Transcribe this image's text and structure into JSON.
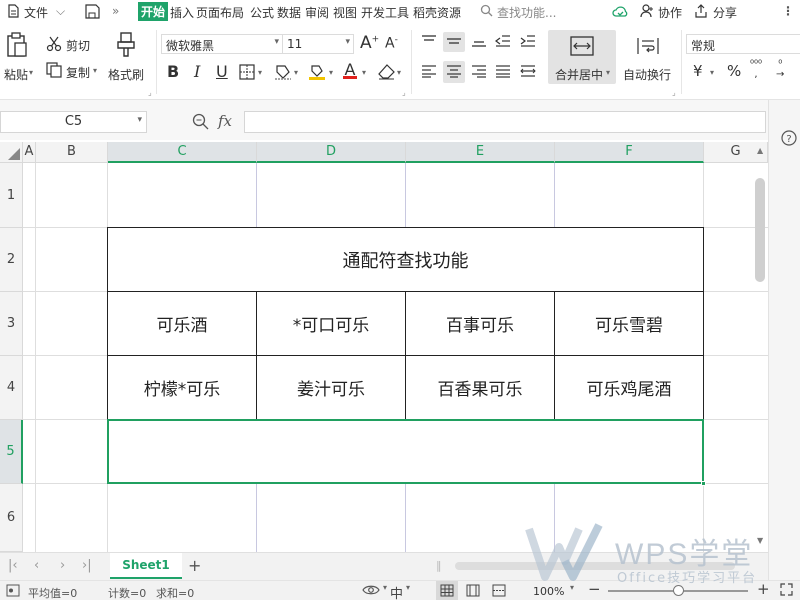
{
  "menu": {
    "file": "文件",
    "tabs": [
      "开始",
      "插入",
      "页面布局",
      "公式",
      "数据",
      "审阅",
      "视图",
      "开发工具",
      "稻壳资源"
    ],
    "search": "查找功能...",
    "collab": "协作",
    "share": "分享"
  },
  "ribbon": {
    "paste": "粘贴",
    "cut": "剪切",
    "copy": "复制",
    "format_painter": "格式刷",
    "font_name": "微软雅黑",
    "font_size": "11",
    "merge_center": "合并居中",
    "wrap_text": "自动换行",
    "number_format": "常规",
    "currency_symbol": "¥",
    "percent_symbol": "%"
  },
  "formula_bar": {
    "name_box": "C5",
    "fx": "fx",
    "content": ""
  },
  "sheet": {
    "columns": [
      "A",
      "B",
      "C",
      "D",
      "E",
      "F",
      "G"
    ],
    "rows": [
      "1",
      "2",
      "3",
      "4",
      "5",
      "6"
    ],
    "selected_cell": "C5",
    "title": "通配符查找功能",
    "row3": [
      "可乐酒",
      "*可口可乐",
      "百事可乐",
      "可乐雪碧"
    ],
    "row4": [
      "柠檬*可乐",
      "姜汁可乐",
      "百香果可乐",
      "可乐鸡尾酒"
    ]
  },
  "tabs": {
    "sheet1": "Sheet1",
    "add": "+"
  },
  "status": {
    "average": "平均值=0",
    "count": "计数=0",
    "sum": "求和=0",
    "zoom": "100%"
  },
  "watermark": {
    "brand": "WPS学堂",
    "slogan": "Office技巧学习平台"
  },
  "colors": {
    "accent": "#1fa36a",
    "selection": "#20a060"
  }
}
